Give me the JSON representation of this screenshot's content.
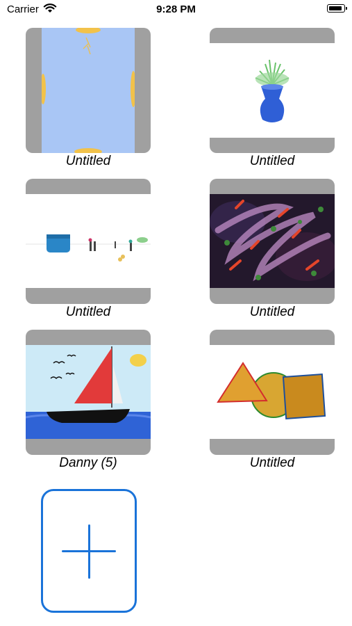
{
  "status_bar": {
    "carrier": "Carrier",
    "time": "9:28 PM",
    "wifi_icon": "wifi-icon",
    "battery_icon": "battery-icon"
  },
  "gallery": {
    "items": [
      {
        "caption": "Untitled",
        "art": "light-blue-canvas"
      },
      {
        "caption": "Untitled",
        "art": "vase-with-plant"
      },
      {
        "caption": "Untitled",
        "art": "beach-scene"
      },
      {
        "caption": "Untitled",
        "art": "abstract-swirls"
      },
      {
        "caption": "Danny (5)",
        "art": "sailboat"
      },
      {
        "caption": "Untitled",
        "art": "shapes"
      }
    ],
    "add_button_icon": "plus-icon"
  },
  "colors": {
    "accent": "#1a73d9",
    "thumb_frame": "#a0a0a0"
  }
}
